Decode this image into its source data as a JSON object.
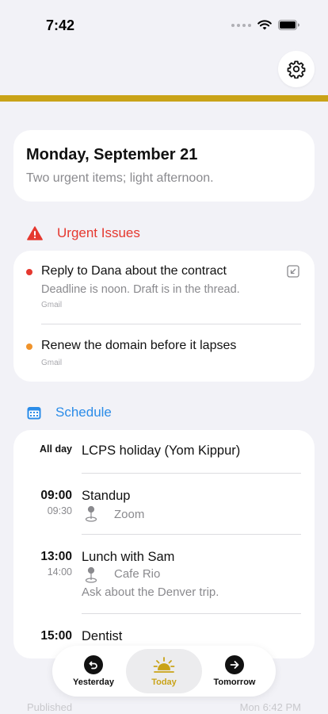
{
  "status_bar": {
    "time": "7:42"
  },
  "date_card": {
    "title": "Monday, September 21",
    "summary": "Two urgent items; light afternoon."
  },
  "urgent": {
    "heading": "Urgent Issues",
    "items": [
      {
        "title": "Reply to Dana about the contract",
        "description": "Deadline is noon. Draft is in the thread.",
        "source": "Gmail",
        "dot_color": "#e5382f"
      },
      {
        "title": "Renew the domain before it lapses",
        "source": "Gmail",
        "dot_color": "#f0932b"
      }
    ]
  },
  "schedule": {
    "heading": "Schedule",
    "events": [
      {
        "start": "All day",
        "title": "LCPS holiday (Yom Kippur)"
      },
      {
        "start": "09:00",
        "end": "09:30",
        "title": "Standup",
        "location": "Zoom"
      },
      {
        "start": "13:00",
        "end": "14:00",
        "title": "Lunch with Sam",
        "location": "Cafe Rio",
        "note": "Ask about the Denver trip."
      },
      {
        "start": "15:00",
        "title": "Dentist"
      }
    ]
  },
  "footer": {
    "published_label": "Published",
    "published_time": "Mon 6:42 PM"
  },
  "nav": {
    "yesterday": "Yesterday",
    "today": "Today",
    "tomorrow": "Tomorrow"
  },
  "colors": {
    "accent_gold": "#c9a318",
    "urgent_red": "#e5382f",
    "schedule_blue": "#2b8ce8",
    "background": "#f2f2f7"
  }
}
